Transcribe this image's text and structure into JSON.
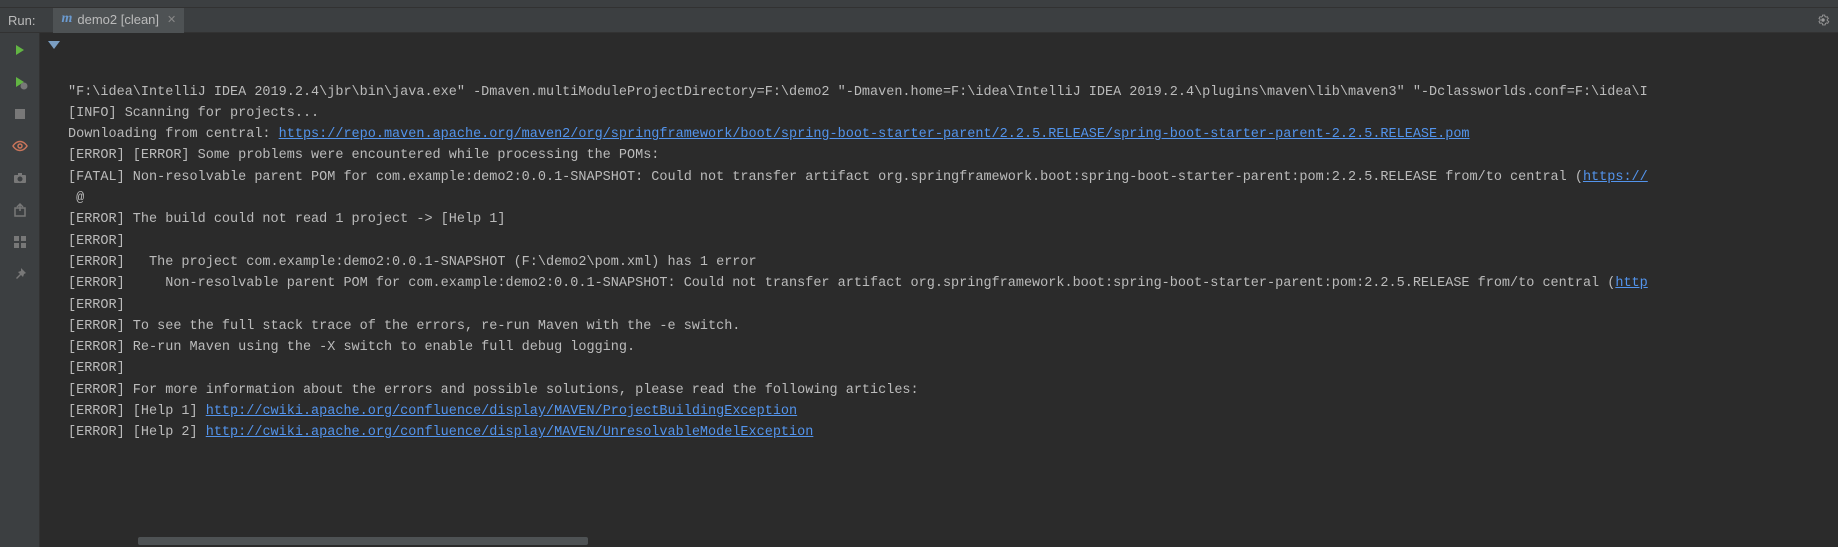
{
  "header": {
    "run_label": "Run:",
    "tab_label": "demo2 [clean]"
  },
  "console": {
    "lines": [
      {
        "segments": [
          {
            "text": "\"F:\\idea\\IntelliJ IDEA 2019.2.4\\jbr\\bin\\java.exe\" -Dmaven.multiModuleProjectDirectory=F:\\demo2 \"-Dmaven.home=F:\\idea\\IntelliJ IDEA 2019.2.4\\plugins\\maven\\lib\\maven3\" \"-Dclassworlds.conf=F:\\idea\\I"
          }
        ]
      },
      {
        "segments": [
          {
            "text": "[INFO] Scanning for projects..."
          }
        ]
      },
      {
        "segments": [
          {
            "text": "Downloading from central: "
          },
          {
            "text": "https://repo.maven.apache.org/maven2/org/springframework/boot/spring-boot-starter-parent/2.2.5.RELEASE/spring-boot-starter-parent-2.2.5.RELEASE.pom",
            "link": true
          }
        ]
      },
      {
        "segments": [
          {
            "text": "[ERROR] [ERROR] Some problems were encountered while processing the POMs:"
          }
        ]
      },
      {
        "segments": [
          {
            "text": "[FATAL] Non-resolvable parent POM for com.example:demo2:0.0.1-SNAPSHOT: Could not transfer artifact org.springframework.boot:spring-boot-starter-parent:pom:2.2.5.RELEASE from/to central ("
          },
          {
            "text": "https://",
            "link": true
          }
        ]
      },
      {
        "segments": [
          {
            "text": " @"
          }
        ]
      },
      {
        "segments": [
          {
            "text": "[ERROR] The build could not read 1 project -> [Help 1]"
          }
        ]
      },
      {
        "segments": [
          {
            "text": "[ERROR]"
          }
        ]
      },
      {
        "segments": [
          {
            "text": "[ERROR]   The project com.example:demo2:0.0.1-SNAPSHOT (F:\\demo2\\pom.xml) has 1 error"
          }
        ]
      },
      {
        "segments": [
          {
            "text": "[ERROR]     Non-resolvable parent POM for com.example:demo2:0.0.1-SNAPSHOT: Could not transfer artifact org.springframework.boot:spring-boot-starter-parent:pom:2.2.5.RELEASE from/to central ("
          },
          {
            "text": "http",
            "link": true
          }
        ]
      },
      {
        "segments": [
          {
            "text": "[ERROR]"
          }
        ]
      },
      {
        "segments": [
          {
            "text": "[ERROR] To see the full stack trace of the errors, re-run Maven with the -e switch."
          }
        ]
      },
      {
        "segments": [
          {
            "text": "[ERROR] Re-run Maven using the -X switch to enable full debug logging."
          }
        ]
      },
      {
        "segments": [
          {
            "text": "[ERROR]"
          }
        ]
      },
      {
        "segments": [
          {
            "text": "[ERROR] For more information about the errors and possible solutions, please read the following articles:"
          }
        ]
      },
      {
        "segments": [
          {
            "text": "[ERROR] [Help 1] "
          },
          {
            "text": "http://cwiki.apache.org/confluence/display/MAVEN/ProjectBuildingException",
            "link": true
          }
        ]
      },
      {
        "segments": [
          {
            "text": "[ERROR] [Help 2] "
          },
          {
            "text": "http://cwiki.apache.org/confluence/display/MAVEN/UnresolvableModelException",
            "link": true
          }
        ]
      }
    ]
  }
}
